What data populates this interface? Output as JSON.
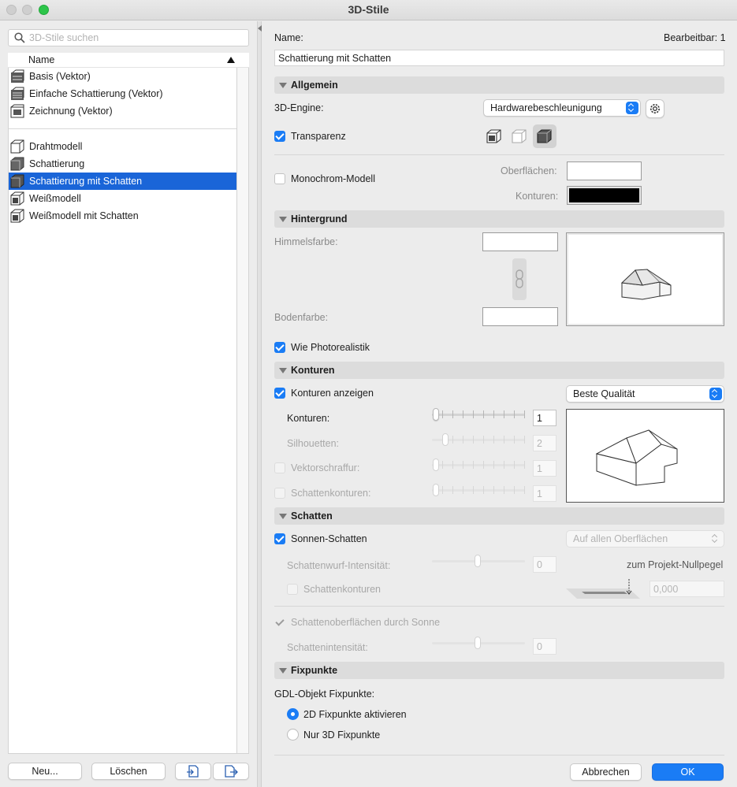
{
  "window": {
    "title": "3D-Stile",
    "traffic_lights": {
      "close": "#cfcfcf",
      "minimize": "#cfcfcf",
      "zoom": "#2dc54a"
    }
  },
  "left": {
    "search_placeholder": "3D-Stile suchen",
    "list_header": "Name",
    "items": [
      {
        "label": "Basis (Vektor)",
        "icon": "vector-style-icon"
      },
      {
        "label": "Einfache Schattierung (Vektor)",
        "icon": "vector-shading-style-icon"
      },
      {
        "label": "Zeichnung (Vektor)",
        "icon": "vector-drawing-style-icon"
      },
      {
        "label": "Drahtmodell",
        "icon": "wireframe-style-icon"
      },
      {
        "label": "Schattierung",
        "icon": "shading-style-icon"
      },
      {
        "label": "Schattierung mit Schatten",
        "icon": "shading-shadow-style-icon",
        "selected": true
      },
      {
        "label": "Weißmodell",
        "icon": "white-model-style-icon"
      },
      {
        "label": "Weißmodell mit Schatten",
        "icon": "white-model-shadow-style-icon"
      }
    ],
    "buttons": {
      "new": "Neu...",
      "delete": "Löschen"
    },
    "selection_color": "#1a65d8"
  },
  "right": {
    "name_label": "Name:",
    "editable_label": "Bearbeitbar: 1",
    "name_value": "Schattierung mit Schatten",
    "sections": {
      "allgemein": "Allgemein",
      "hintergrund": "Hintergrund",
      "konturen": "Konturen",
      "schatten": "Schatten",
      "fixpunkte": "Fixpunkte"
    },
    "allgemein": {
      "engine_label": "3D-Engine:",
      "engine_value": "Hardwarebeschleunigung",
      "transparency_label": "Transparenz",
      "transparency_checked": true,
      "mono_label": "Monochrom-Modell",
      "mono_checked": false,
      "surfaces_label": "Oberflächen:",
      "surfaces_color": "#ffffff",
      "contours_label": "Konturen:",
      "contours_color": "#000000"
    },
    "hintergrund": {
      "sky_label": "Himmelsfarbe:",
      "sky_color": "#ffffff",
      "ground_label": "Bodenfarbe:",
      "ground_color": "#ffffff",
      "photo_label": "Wie Photorealistik",
      "photo_checked": true
    },
    "konturen": {
      "show_label": "Konturen anzeigen",
      "show_checked": true,
      "quality_value": "Beste Qualität",
      "contours_label": "Konturen:",
      "contours_value": "1",
      "silhouettes_label": "Silhouetten:",
      "silhouettes_value": "2",
      "vector_hatch_label": "Vektorschraffur:",
      "vector_hatch_value": "1",
      "shadow_contours_label": "Schattenkonturen:",
      "shadow_contours_value": "1"
    },
    "schatten": {
      "sun_label": "Sonnen-Schatten",
      "sun_checked": true,
      "surfaces_value": "Auf allen Oberflächen",
      "intensity_label": "Schattenwurf-Intensität:",
      "intensity_value": "0",
      "contours_label": "Schattenkonturen",
      "zero_level_label": "zum Projekt-Nullpegel",
      "zero_level_value": "0,000",
      "sun_surfaces_label": "Schattenoberflächen durch Sonne",
      "shadow_intensity_label": "Schattenintensität:",
      "shadow_intensity_value": "0"
    },
    "fixpunkte": {
      "gdl_label": "GDL-Objekt Fixpunkte:",
      "option_2d": "2D Fixpunkte aktivieren",
      "option_3d": "Nur 3D Fixpunkte",
      "selected": "2d"
    },
    "buttons": {
      "cancel": "Abbrechen",
      "ok": "OK"
    },
    "accent_color": "#1a7cf5"
  }
}
